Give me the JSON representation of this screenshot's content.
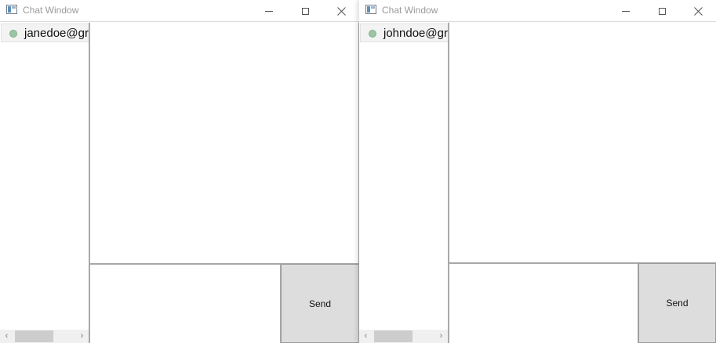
{
  "windows": [
    {
      "title": "Chat Window",
      "contacts": [
        {
          "label": "janedoe@gr",
          "status": "online"
        }
      ],
      "send_label": "Send",
      "scroll": {
        "left_arrow": "‹",
        "right_arrow": "›"
      }
    },
    {
      "title": "Chat Window",
      "contacts": [
        {
          "label": "johndoe@gr",
          "status": "online"
        }
      ],
      "send_label": "Send",
      "scroll": {
        "left_arrow": "‹",
        "right_arrow": "›"
      }
    }
  ],
  "icons": {
    "app": "chat-window-app-icon",
    "minimize": "minimize-icon",
    "maximize": "maximize-icon",
    "close": "close-icon",
    "status": "status-dot-icon"
  },
  "colors": {
    "status_online": "#9cc5a3",
    "send_button_bg": "#dcdddc",
    "title_text": "#9a9a9a",
    "scrollbar_thumb": "#cdcdcd"
  }
}
